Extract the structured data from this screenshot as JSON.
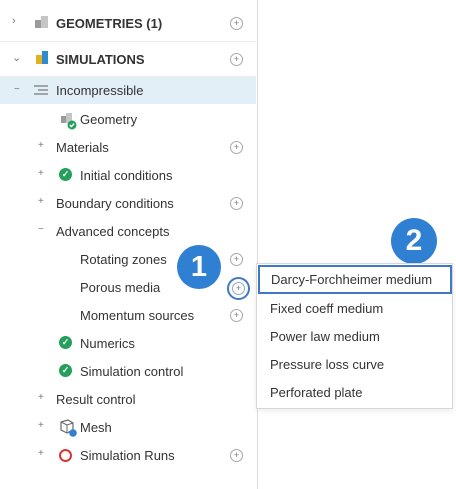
{
  "tree": {
    "geometries_label": "GEOMETRIES (1)",
    "simulations_label": "SIMULATIONS",
    "incompressible_label": "Incompressible",
    "geometry_label": "Geometry",
    "materials_label": "Materials",
    "initial_conditions_label": "Initial conditions",
    "boundary_conditions_label": "Boundary conditions",
    "advanced_concepts_label": "Advanced concepts",
    "rotating_zones_label": "Rotating zones",
    "porous_media_label": "Porous media",
    "momentum_sources_label": "Momentum sources",
    "numerics_label": "Numerics",
    "simulation_control_label": "Simulation control",
    "result_control_label": "Result control",
    "mesh_label": "Mesh",
    "simulation_runs_label": "Simulation Runs"
  },
  "context_menu": {
    "items": [
      "Darcy-Forchheimer medium",
      "Fixed coeff medium",
      "Power law medium",
      "Pressure loss curve",
      "Perforated plate"
    ]
  },
  "annotations": {
    "step1": "1",
    "step2": "2"
  },
  "colors": {
    "selected_row": "#e3eff6",
    "accent": "#2f7fd2",
    "check": "#23a05a",
    "error": "#d93636"
  }
}
